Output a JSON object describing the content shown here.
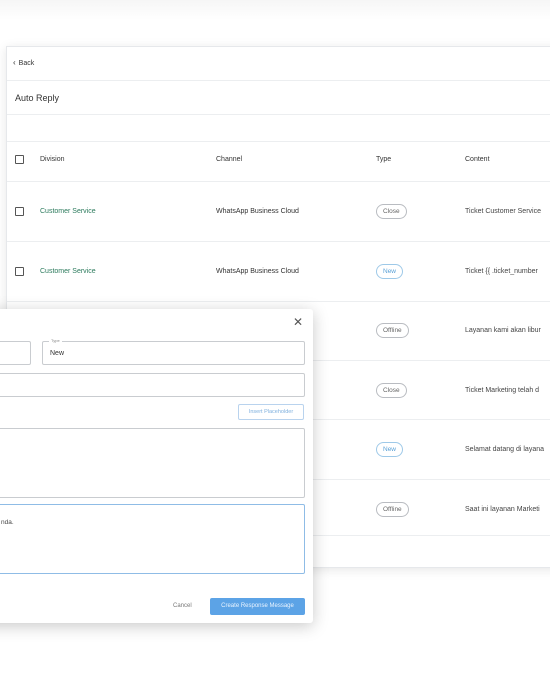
{
  "header": {
    "back_label": "Back",
    "title": "Auto Reply"
  },
  "table": {
    "columns": [
      "Division",
      "Channel",
      "Type",
      "Content"
    ],
    "rows": [
      {
        "division": "Customer Service",
        "channel": "WhatsApp Business Cloud",
        "type": "Close",
        "content": "Ticket Customer Service"
      },
      {
        "division": "Customer Service",
        "channel": "WhatsApp Business Cloud",
        "type": "New",
        "content": "Ticket {{ .ticket_number"
      },
      {
        "division": "",
        "channel": "",
        "type": "Offline",
        "content": "Layanan kami akan libur"
      },
      {
        "division": "",
        "channel": "",
        "type": "Close",
        "content": "Ticket Marketing telah d"
      },
      {
        "division": "",
        "channel": "",
        "type": "New",
        "content": "Selamat datang di layana"
      },
      {
        "division": "",
        "channel": "",
        "type": "Offline",
        "content": "Saat ini layanan Marketi"
      }
    ]
  },
  "modal": {
    "type_label": "Type",
    "type_value": "New",
    "insert_placeholder_label": "Insert Placeholder",
    "message_fragment": "nda.",
    "cancel_label": "Cancel",
    "create_label": "Create Response Message"
  },
  "icons": {
    "back": "chevron-left-icon",
    "close": "close-icon"
  },
  "colors": {
    "accent": "#5ca3e6",
    "division_text": "#2b7a5c",
    "new_badge": "#5aa0d6"
  }
}
